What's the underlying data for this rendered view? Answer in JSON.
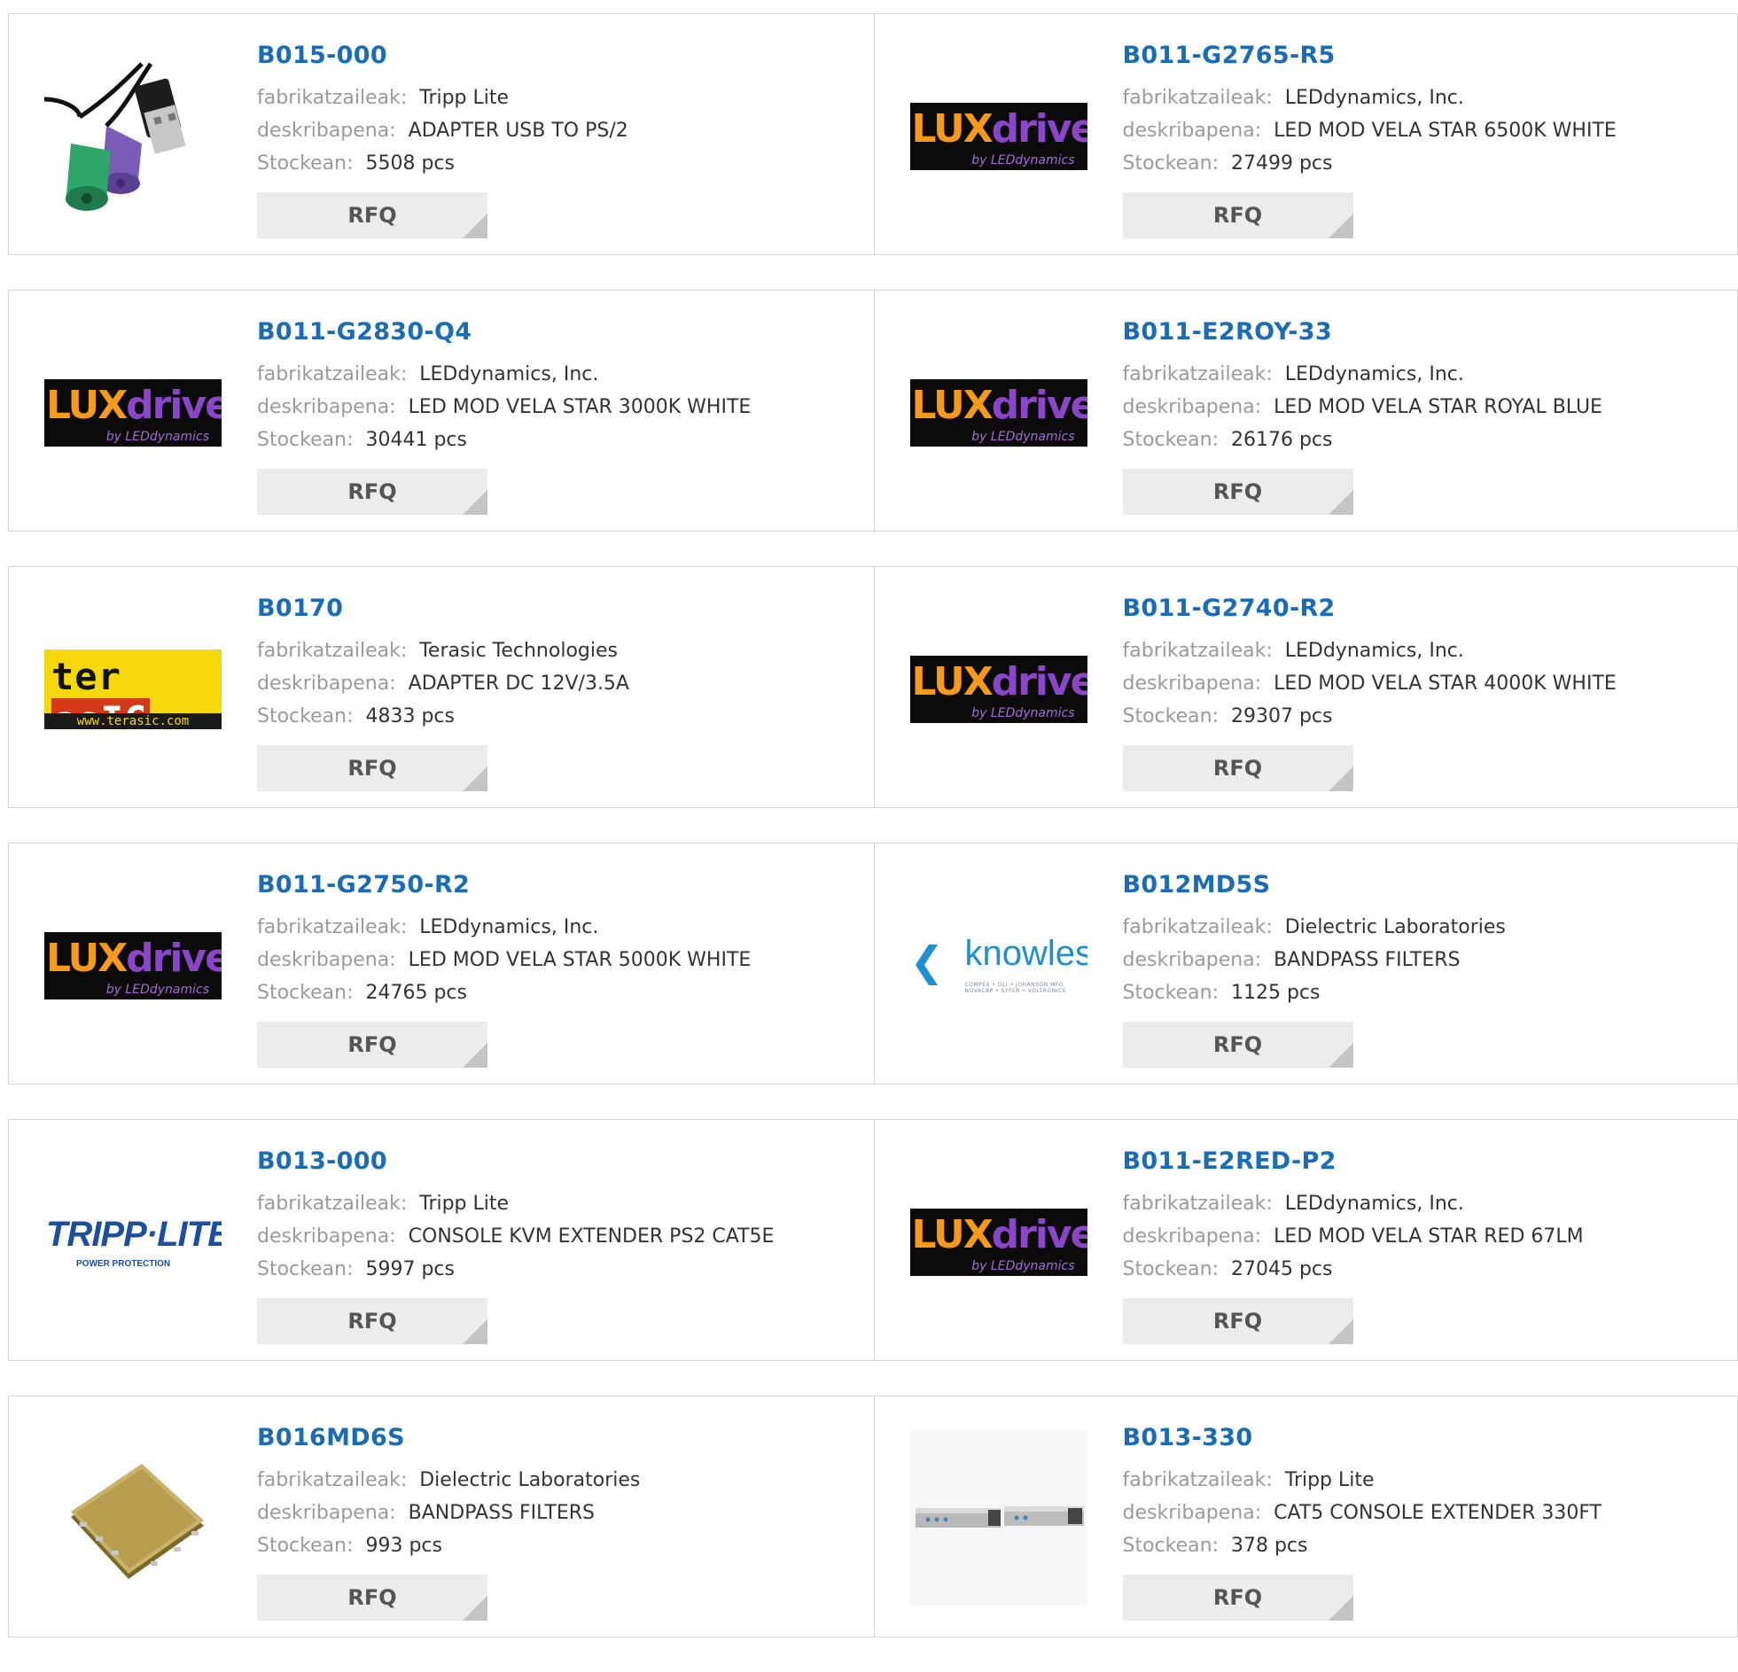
{
  "labels": {
    "manufacturer": "fabrikatzaileak:",
    "description": "deskribapena:",
    "stock": "Stockean:",
    "rfq": "RFQ"
  },
  "products": [
    {
      "part": "B015-000",
      "manufacturer": "Tripp Lite",
      "description": "ADAPTER USB TO PS/2",
      "stock": "5508 pcs",
      "image": "usb-ps2-cable-icon"
    },
    {
      "part": "B011-G2765-R5",
      "manufacturer": "LEDdynamics, Inc.",
      "description": "LED MOD VELA STAR 6500K WHITE",
      "stock": "27499 pcs",
      "image": "luxdrive-logo"
    },
    {
      "part": "B011-G2830-Q4",
      "manufacturer": "LEDdynamics, Inc.",
      "description": "LED MOD VELA STAR 3000K WHITE",
      "stock": "30441 pcs",
      "image": "luxdrive-logo"
    },
    {
      "part": "B011-E2ROY-33",
      "manufacturer": "LEDdynamics, Inc.",
      "description": "LED MOD VELA STAR ROYAL BLUE",
      "stock": "26176 pcs",
      "image": "luxdrive-logo"
    },
    {
      "part": "B0170",
      "manufacturer": "Terasic Technologies",
      "description": "ADAPTER DC 12V/3.5A",
      "stock": "4833 pcs",
      "image": "terasic-logo"
    },
    {
      "part": "B011-G2740-R2",
      "manufacturer": "LEDdynamics, Inc.",
      "description": "LED MOD VELA STAR 4000K WHITE",
      "stock": "29307 pcs",
      "image": "luxdrive-logo"
    },
    {
      "part": "B011-G2750-R2",
      "manufacturer": "LEDdynamics, Inc.",
      "description": "LED MOD VELA STAR 5000K WHITE",
      "stock": "24765 pcs",
      "image": "luxdrive-logo"
    },
    {
      "part": "B012MD5S",
      "manufacturer": "Dielectric Laboratories",
      "description": "BANDPASS FILTERS",
      "stock": "1125 pcs",
      "image": "knowles-logo"
    },
    {
      "part": "B013-000",
      "manufacturer": "Tripp Lite",
      "description": "CONSOLE KVM EXTENDER PS2 CAT5E",
      "stock": "5997 pcs",
      "image": "tripp-lite-logo"
    },
    {
      "part": "B011-E2RED-P2",
      "manufacturer": "LEDdynamics, Inc.",
      "description": "LED MOD VELA STAR RED 67LM",
      "stock": "27045 pcs",
      "image": "luxdrive-logo"
    },
    {
      "part": "B016MD6S",
      "manufacturer": "Dielectric Laboratories",
      "description": "BANDPASS FILTERS",
      "stock": "993 pcs",
      "image": "gold-chip-icon"
    },
    {
      "part": "B013-330",
      "manufacturer": "Tripp Lite",
      "description": "CAT5 CONSOLE EXTENDER 330FT",
      "stock": "378 pcs",
      "image": "console-extender-icon"
    }
  ],
  "logos": {
    "luxdrive": {
      "lux": "LUX",
      "drive": "drive",
      "by": "by LEDdynamics"
    },
    "terasic": {
      "ter": "ter",
      "asic": "asIC",
      "url": "www.terasic.com"
    },
    "tripp": {
      "name": "TRIPP·LITE",
      "tag": "POWER PROTECTION"
    },
    "knowles": {
      "name": "knowles",
      "sub": "COMPEX • DLI • JOHANSON MFG  NOVACAP • SYFER • VOLTRONICS"
    }
  },
  "colors": {
    "link": "#1a6cb5",
    "label": "#9a9a9a",
    "button_bg": "#ececec",
    "border": "#d4d4d4"
  }
}
